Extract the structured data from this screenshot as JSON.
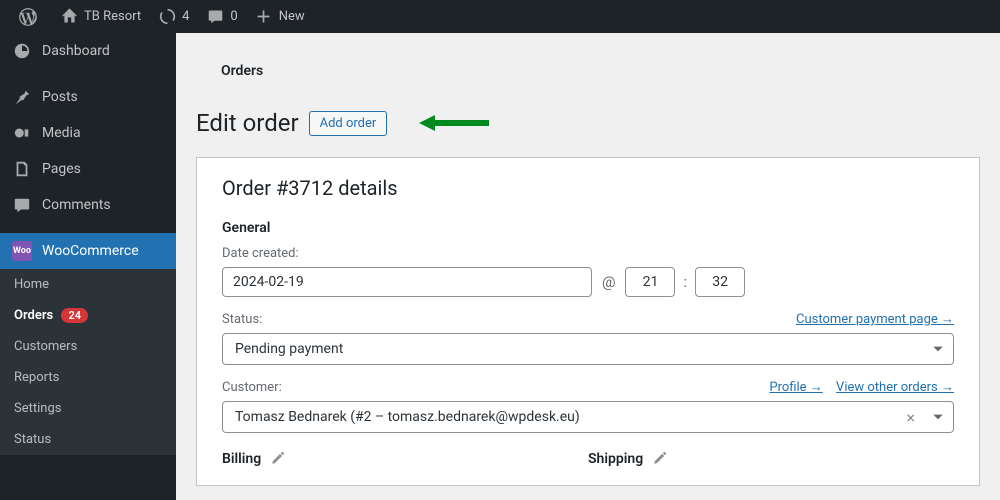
{
  "adminbar": {
    "site_name": "TB Resort",
    "updates_count": "4",
    "comments_count": "0",
    "new_label": "New"
  },
  "sidebar": {
    "dashboard": "Dashboard",
    "posts": "Posts",
    "media": "Media",
    "pages": "Pages",
    "comments": "Comments",
    "woocommerce": "WooCommerce",
    "submenu": {
      "home": "Home",
      "orders": "Orders",
      "orders_count": "24",
      "customers": "Customers",
      "reports": "Reports",
      "settings": "Settings",
      "status": "Status"
    }
  },
  "page": {
    "heading": "Orders",
    "title": "Edit order",
    "add_button": "Add order"
  },
  "order": {
    "panel_title": "Order #3712 details",
    "general_label": "General",
    "date_label": "Date created:",
    "date_value": "2024-02-19",
    "at_text": "@",
    "hour": "21",
    "minute": "32",
    "time_sep": ":",
    "status_label": "Status:",
    "status_value": "Pending payment",
    "payment_page_link": "Customer payment page →",
    "customer_label": "Customer:",
    "customer_value": "Tomasz Bednarek (#2 – tomasz.bednarek@wpdesk.eu)",
    "profile_link": "Profile →",
    "view_orders_link": "View other orders →",
    "billing_label": "Billing",
    "shipping_label": "Shipping"
  }
}
